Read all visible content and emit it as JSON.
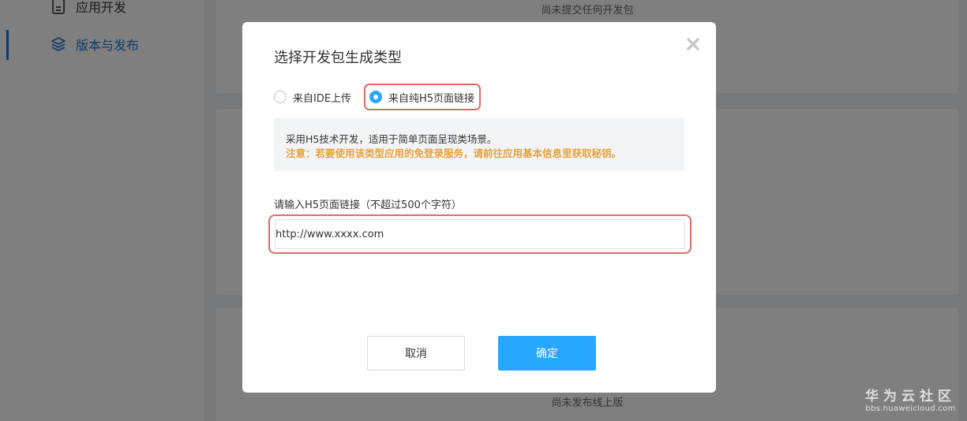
{
  "background": {
    "sidebar": {
      "items": [
        {
          "label": "应用开发",
          "icon": "document-icon"
        },
        {
          "label": "版本与发布",
          "icon": "layers-icon",
          "active": true
        }
      ]
    },
    "panels": {
      "top_empty_text": "尚未提交任何开发包",
      "bottom_empty_text": "尚未发布线上版"
    }
  },
  "dialog": {
    "title": "选择开发包生成类型",
    "close_icon": "close-icon",
    "radio_options": [
      {
        "label": "来自IDE上传",
        "checked": false
      },
      {
        "label": "来自纯H5页面链接",
        "checked": true
      }
    ],
    "info": {
      "line1": "采用H5技术开发，适用于简单页面呈现类场景。",
      "line2": "注意：若要使用该类型应用的免登录服务，请前往应用基本信息里获取秘钥。"
    },
    "url_field": {
      "label": "请输入H5页面链接（不超过500个字符）",
      "value": "http://www.xxxx.com"
    },
    "buttons": {
      "cancel": "取消",
      "confirm": "确定"
    }
  },
  "watermark": {
    "title": "华为云社区",
    "url": "bbs.huaweicloud.com"
  },
  "colors": {
    "primary": "#28a7ff",
    "highlight_border": "#e06b63",
    "warning_text": "#e6a23c",
    "info_bg": "#f3f4f6"
  }
}
